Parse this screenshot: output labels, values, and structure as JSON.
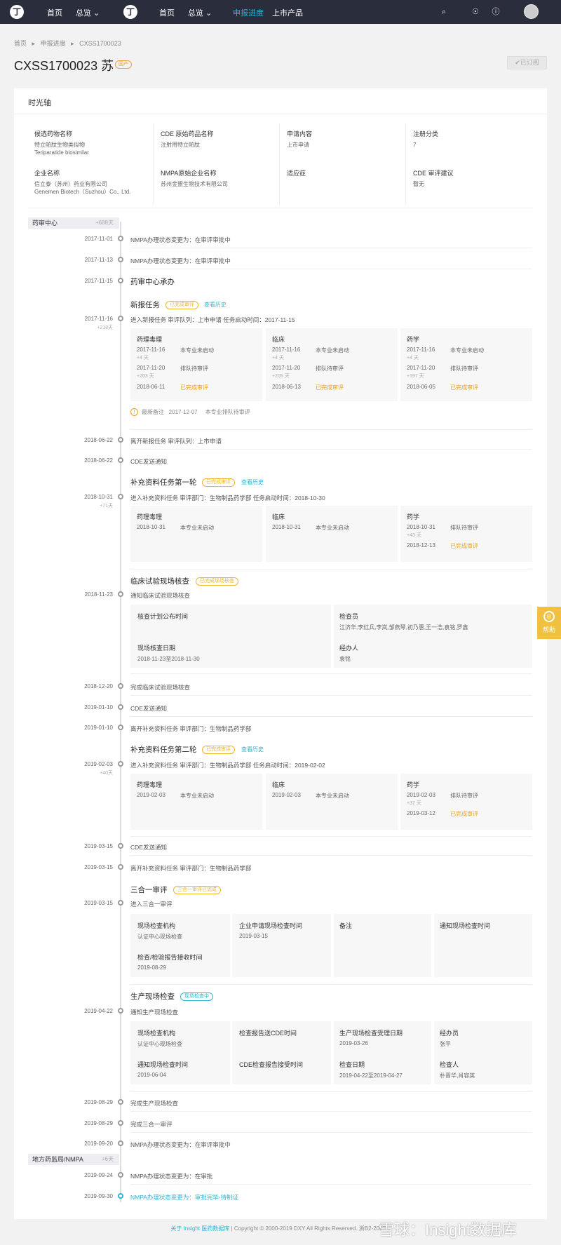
{
  "nav": {
    "logo": "丁",
    "home1": "首页",
    "overview1": "总览 ⌄",
    "home2": "首页",
    "overview2": "总览 ⌄",
    "progress": "申报进度",
    "listed": "上市产品",
    "accent": "#29b6d6"
  },
  "breadcrumb": {
    "c1": "首页",
    "sep": "▸",
    "c2": "申报进度",
    "c3": "CXSS1700023"
  },
  "header": {
    "title": "CXSS1700023 苏",
    "badge": "国产",
    "subscribe": "✔已订阅"
  },
  "card": {
    "title": "时光轴"
  },
  "info": [
    {
      "label": "候选药物名称",
      "value": "特立帕肽生物类似物",
      "value2": "Teriparatide biosimilar"
    },
    {
      "label": "CDE 原始药品名称",
      "value": "注射用特立帕肽",
      "value2": ""
    },
    {
      "label": "申请内容",
      "value": "上市申请",
      "value2": ""
    },
    {
      "label": "注册分类",
      "value": "7",
      "value2": ""
    },
    {
      "label": "企业名称",
      "value": "信立泰（苏州）药业有限公司",
      "value2": "Genemen Biotech（Suzhou）Co., Ltd."
    },
    {
      "label": "NMPA原始企业名称",
      "value": "苏州金盟生物技术有限公司",
      "value2": ""
    },
    {
      "label": "适应症",
      "value": "",
      "value2": ""
    },
    {
      "label": "CDE 审评建议",
      "value": "暂无",
      "value2": ""
    }
  ],
  "sections": {
    "cde": {
      "name": "药审中心",
      "count": "+688天"
    },
    "nmpa": {
      "name": "地方药监局/NMPA",
      "count": "+6天"
    }
  },
  "events": {
    "e1": {
      "date": "2017-11-01",
      "text": "NMPA办理状态变更为：在审评审批中"
    },
    "e2": {
      "date": "2017-11-13",
      "text": "NMPA办理状态变更为：在审评审批中"
    },
    "e3": {
      "date": "2017-11-15",
      "text": "药审中心承办"
    },
    "e4": {
      "date": "2017-11-16",
      "dur": "+218天",
      "title": "新报任务",
      "tag": "已完成审评",
      "link": "查看历史",
      "sub": "进入新报任务   审评队列：上市申请   任务启动时间：2017-11-15"
    },
    "e5": {
      "date": "2018-06-22",
      "text": "离开新报任务   审评队列：上市申请"
    },
    "e6": {
      "date": "2018-06-22",
      "text": "CDE发送通知"
    },
    "e7": {
      "date": "2018-10-31",
      "dur": "+71天",
      "title": "补充资料任务第一轮",
      "tag": "已完成审评",
      "link": "查看历史",
      "sub": "进入补充资料任务   审评部门：生物制品药学部   任务启动时间：2018-10-30"
    },
    "e8": {
      "date": "2018-11-23",
      "title": "临床试验现场核查",
      "tag": "已完成现场核查",
      "sub": "通知临床试验现场核查"
    },
    "e9": {
      "date": "2018-12-20",
      "text": "完成临床试验现场核查"
    },
    "e10": {
      "date": "2019-01-10",
      "text": "CDE发送通知"
    },
    "e11": {
      "date": "2019-01-10",
      "text": "离开补充资料任务   审评部门：生物制品药学部"
    },
    "e12": {
      "date": "2019-02-03",
      "dur": "+40天",
      "title": "补充资料任务第二轮",
      "tag": "已完成审评",
      "link": "查看历史",
      "sub": "进入补充资料任务   审评部门：生物制品药学部   任务启动时间：2019-02-02"
    },
    "e13": {
      "date": "2019-03-15",
      "text": "CDE发送通知"
    },
    "e14": {
      "date": "2019-03-15",
      "text": "离开补充资料任务   审评部门：生物制品药学部"
    },
    "e15": {
      "date": "2019-03-15",
      "title": "三合一审评",
      "tag": "三合一审评已完成",
      "sub": "进入三合一审评"
    },
    "e16": {
      "date": "2019-04-22",
      "title": "生产现场检查",
      "tag": "现场检查中",
      "sub": "通知生产现场检查"
    },
    "e17": {
      "date": "2019-08-29",
      "text": "完成生产现场检查"
    },
    "e18": {
      "date": "2019-08-29",
      "text": "完成三合一审评"
    },
    "e19": {
      "date": "2019-09-20",
      "text": "NMPA办理状态变更为：在审评审批中"
    },
    "e20": {
      "date": "2019-09-24",
      "text": "NMPA办理状态变更为：在审批"
    },
    "e21": {
      "date": "2019-09-30",
      "text": "NMPA办理状态变更为：审批完毕-待制证"
    }
  },
  "task1": {
    "pharm": {
      "h": "药理毒理",
      "r1d": "2017-11-16",
      "r1s": "本专业未启动",
      "r1x": "+4 天",
      "r2d": "2017-11-20",
      "r2s": "排队待审评",
      "r2x": "+203 天",
      "r3d": "2018-06-11",
      "r3s": "已完成审评"
    },
    "clin": {
      "h": "临床",
      "r1d": "2017-11-16",
      "r1s": "本专业未启动",
      "r1x": "+4 天",
      "r2d": "2017-11-20",
      "r2s": "排队待审评",
      "r2x": "+205 天",
      "r3d": "2018-06-13",
      "r3s": "已完成审评"
    },
    "chem": {
      "h": "药学",
      "r1d": "2017-11-16",
      "r1s": "本专业未启动",
      "r1x": "+4 天",
      "r2d": "2017-11-20",
      "r2s": "排队待审评",
      "r2x": "+197 天",
      "r3d": "2018-06-05",
      "r3s": "已完成审评"
    },
    "note": {
      "icon": "!",
      "label": "最新备注",
      "date": "2017-12-07",
      "text": "本专业排队待审评"
    }
  },
  "task2": {
    "pharm": {
      "h": "药理毒理",
      "r1d": "2018-10-31",
      "r1s": "本专业未启动"
    },
    "clin": {
      "h": "临床",
      "r1d": "2018-10-31",
      "r1s": "本专业未启动"
    },
    "chem": {
      "h": "药学",
      "r1d": "2018-10-31",
      "r1s": "排队待审评",
      "r1x": "+43 天",
      "r2d": "2018-12-13",
      "r2s": "已完成审评"
    }
  },
  "clinical": {
    "k1": "核查计划公布时间",
    "v1": "",
    "k2": "检查员",
    "v2": "江济华,李红兵,李岚,邹燕琴,初乃惠,王一浩,袁铭,罗鑫",
    "k3": "现场核查日期",
    "v3": "2018-11-23至2018-11-30",
    "k4": "经办人",
    "v4": "袁铭"
  },
  "task3": {
    "pharm": {
      "h": "药理毒理",
      "r1d": "2019-02-03",
      "r1s": "本专业未启动"
    },
    "clin": {
      "h": "临床",
      "r1d": "2019-02-03",
      "r1s": "本专业未启动"
    },
    "chem": {
      "h": "药学",
      "r1d": "2019-02-03",
      "r1s": "排队待审评",
      "r1x": "+37 天",
      "r2d": "2019-03-12",
      "r2s": "已完成审评"
    }
  },
  "three": {
    "k1": "现场检查机构",
    "v1": "认证中心现场检查",
    "k2": "企业申请现场检查时间",
    "v2": "2019-03-15",
    "k3": "备注",
    "v3": "",
    "k4": "通知现场检查时间",
    "v4": "",
    "k5": "检查/检验报告接收时间",
    "v5": "2019-08-29"
  },
  "prod": {
    "k1": "现场检查机构",
    "v1": "认证中心现场检查",
    "k2": "检查报告送CDE时间",
    "v2": "",
    "k3": "生产现场检查受理日期",
    "v3": "2019-03-26",
    "k4": "经办员",
    "v4": "张平",
    "k5": "通知现场检查时间",
    "v5": "2019-06-04",
    "k6": "CDE检查报告接受时间",
    "v6": "",
    "k7": "检查日期",
    "v7": "2019-04-22至2019-04-27",
    "k8": "检查人",
    "v8": "朴晋华,肖容英"
  },
  "help": {
    "icon": "◎",
    "label": "帮助"
  },
  "footer": {
    "about": "关于 Insight 医药数据库",
    "sep": " | ",
    "copy": "Copyright © 2000-2019 DXY All Rights Reserved. 浙B2-2007..."
  },
  "watermark": "雪球：Insight数据库"
}
